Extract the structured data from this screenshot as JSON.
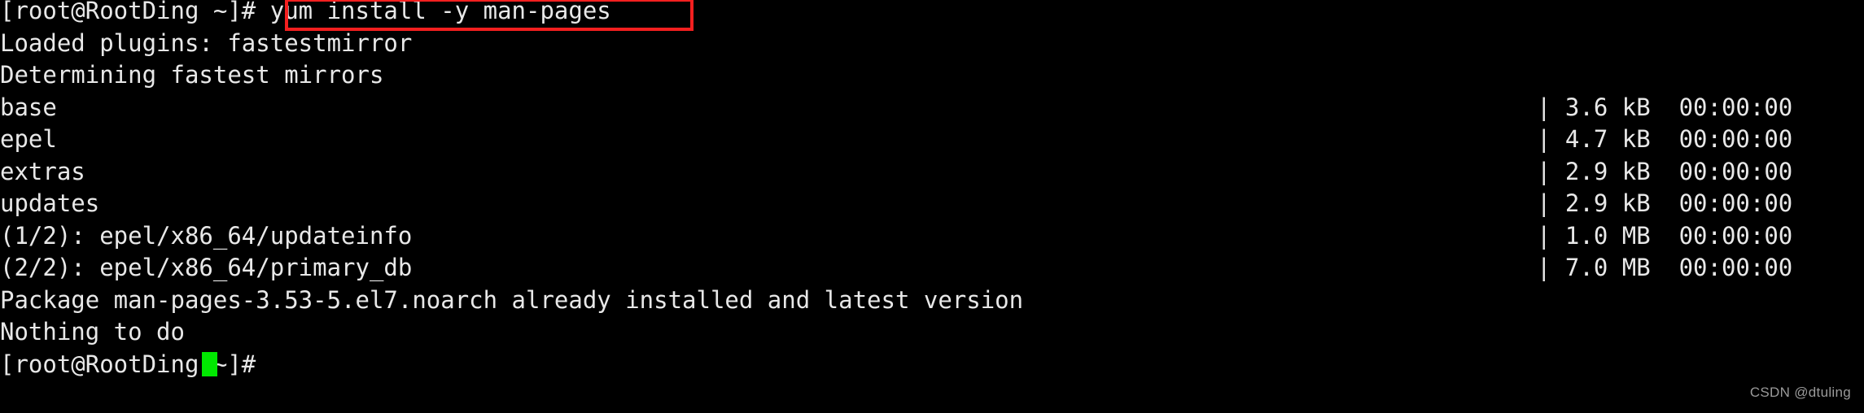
{
  "terminal": {
    "background_color": "#000000",
    "foreground_color": "#e8e8e8",
    "cursor_color": "#00e800",
    "highlight_color": "#f41f1f",
    "prompt": "[root@RootDing ~]#",
    "command": "yum install -y man-pages",
    "lines": [
      {
        "left": "[root@RootDing ~]# yum install -y man-pages",
        "right": ""
      },
      {
        "left": "Loaded plugins: fastestmirror",
        "right": ""
      },
      {
        "left": "Determining fastest mirrors",
        "right": ""
      },
      {
        "left": "base",
        "right": "| 3.6 kB  00:00:00"
      },
      {
        "left": "epel",
        "right": "| 4.7 kB  00:00:00"
      },
      {
        "left": "extras",
        "right": "| 2.9 kB  00:00:00"
      },
      {
        "left": "updates",
        "right": "| 2.9 kB  00:00:00"
      },
      {
        "left": "(1/2): epel/x86_64/updateinfo",
        "right": "| 1.0 MB  00:00:00"
      },
      {
        "left": "(2/2): epel/x86_64/primary_db",
        "right": "| 7.0 MB  00:00:00"
      },
      {
        "left": "Package man-pages-3.53-5.el7.noarch already installed and latest version",
        "right": ""
      },
      {
        "left": "Nothing to do",
        "right": ""
      },
      {
        "left": "[root@RootDing ~]# ",
        "right": ""
      }
    ]
  },
  "watermark": {
    "text": "CSDN @dtuling"
  }
}
